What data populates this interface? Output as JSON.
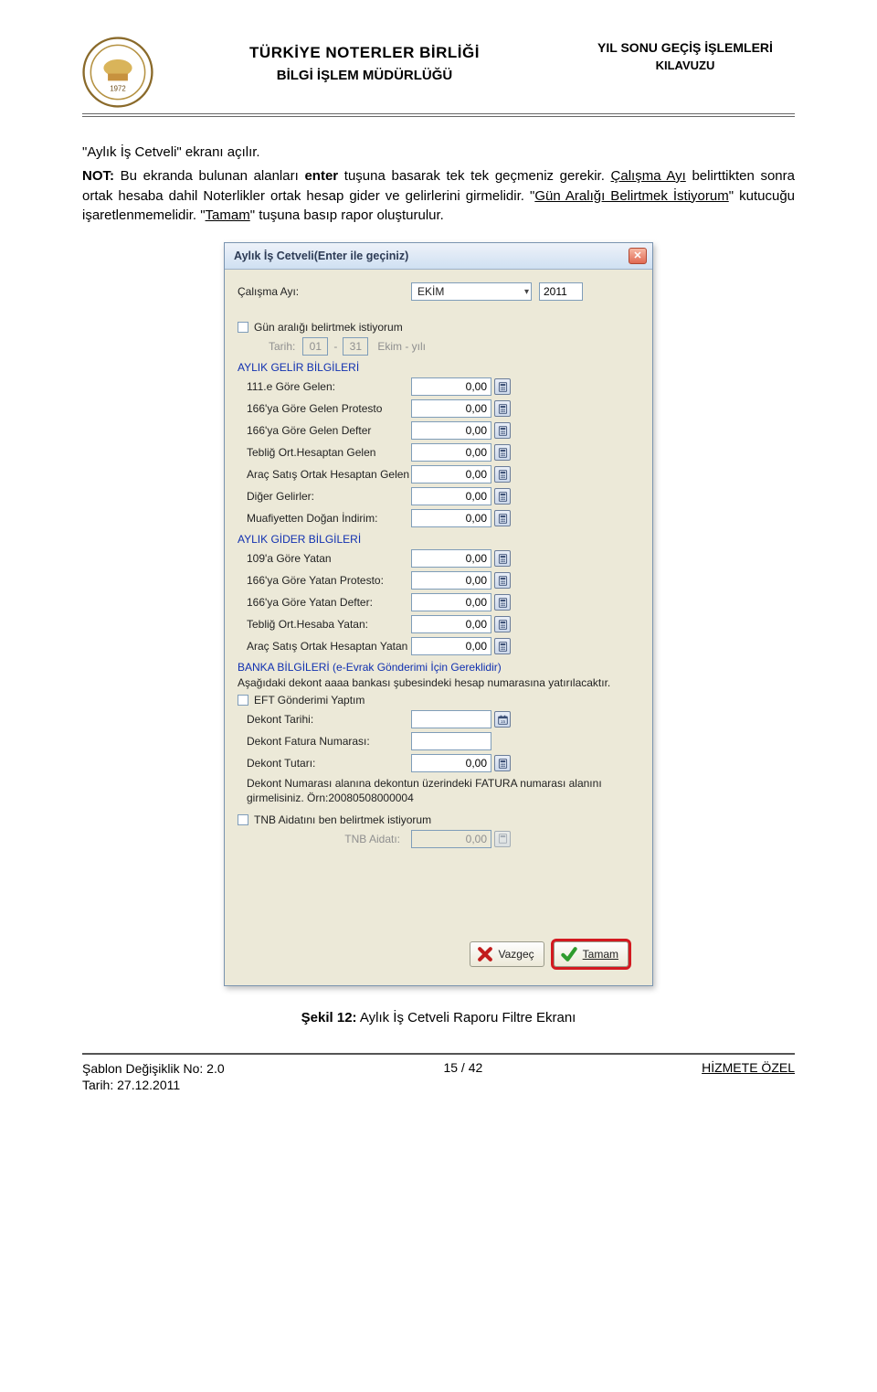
{
  "header": {
    "org": "TÜRKİYE NOTERLER BİRLİĞİ",
    "dept": "BİLGİ İŞLEM MÜDÜRLÜĞÜ",
    "docTitle1": "YIL SONU GEÇİŞ İŞLEMLERİ",
    "docTitle2": "KILAVUZU",
    "logoYear": "1972"
  },
  "body": {
    "p1": "\"Aylık İş Cetveli\" ekranı açılır.",
    "p2_pre": "NOT:",
    "p2_a": " Bu ekranda bulunan alanları ",
    "p2_key": "enter",
    "p2_b": " tuşuna basarak tek tek geçmeniz gerekir. ",
    "p2_c": "Çalışma Ayı",
    "p2_d": " belirttikten sonra ortak hesaba dahil Noterlikler ortak hesap gider ve gelirlerini girmelidir. \"",
    "p2_e": "Gün Aralığı Belirtmek İstiyorum",
    "p2_f": "\" kutucuğu işaretlenmemelidir. \"",
    "p2_g": "Tamam",
    "p2_h": "\" tuşuna basıp rapor oluşturulur."
  },
  "dialog": {
    "title": "Aylık İş Cetveli(Enter ile geçiniz)",
    "calismaAyiLabel": "Çalışma Ayı:",
    "monthValue": "EKİM",
    "yearValue": "2011",
    "gunAraligiLabel": "Gün aralığı belirtmek istiyorum",
    "tarihLabel": "Tarih:",
    "tarihFrom": "01",
    "tarihSep": "-",
    "tarihTo": "31",
    "tarihSuffix": "Ekim - yılı",
    "sec1": "AYLIK GELİR BİLGİLERİ",
    "gelir": [
      {
        "label": "111.e Göre Gelen:",
        "value": "0,00"
      },
      {
        "label": "166'ya Göre Gelen Protesto",
        "value": "0,00"
      },
      {
        "label": "166'ya Göre Gelen Defter",
        "value": "0,00"
      },
      {
        "label": "Tebliğ Ort.Hesaptan Gelen",
        "value": "0,00"
      },
      {
        "label": "Araç Satış Ortak Hesaptan Gelen",
        "value": "0,00"
      },
      {
        "label": "Diğer Gelirler:",
        "value": "0,00"
      },
      {
        "label": "Muafiyetten Doğan İndirim:",
        "value": "0,00"
      }
    ],
    "sec2": "AYLIK GİDER BİLGİLERİ",
    "gider": [
      {
        "label": "109'a Göre Yatan",
        "value": "0,00"
      },
      {
        "label": "166'ya Göre Yatan Protesto:",
        "value": "0,00"
      },
      {
        "label": "166'ya Göre Yatan Defter:",
        "value": "0,00"
      },
      {
        "label": "Tebliğ Ort.Hesaba Yatan:",
        "value": "0,00"
      },
      {
        "label": "Araç Satış Ortak Hesaptan Yatan",
        "value": "0,00"
      }
    ],
    "sec3": "BANKA BİLGİLERİ  (e-Evrak Gönderimi İçin Gereklidir)",
    "bankaNote": "Aşağıdaki dekont aaaa bankası  şubesindeki  hesap numarasına yatırılacaktır.",
    "eftLabel": "EFT Gönderimi Yaptım",
    "dekontTarihiLabel": "Dekont Tarihi:",
    "dekontTarihiValue": "",
    "dekontFaturaLabel": "Dekont Fatura Numarası:",
    "dekontFaturaValue": "",
    "dekontTutariLabel": "Dekont Tutarı:",
    "dekontTutariValue": "0,00",
    "dekontHint": "Dekont Numarası alanına dekontun üzerindeki FATURA numarası alanını girmelisiniz. Örn:20080508000004",
    "tnbChkLabel": "TNB Aidatını ben belirtmek istiyorum",
    "tnbAidatiLabel": "TNB Aidatı:",
    "tnbAidatiValue": "0,00",
    "btnVazgec": "Vazgeç",
    "btnTamam": "Tamam"
  },
  "caption": {
    "bold": "Şekil 12:",
    "rest": " Aylık İş Cetveli Raporu Filtre Ekranı"
  },
  "footer": {
    "l1": "Şablon Değişiklik No: 2.0",
    "l2": "Tarih: 27.12.2011",
    "center": "15 / 42",
    "right": "HİZMETE ÖZEL"
  }
}
